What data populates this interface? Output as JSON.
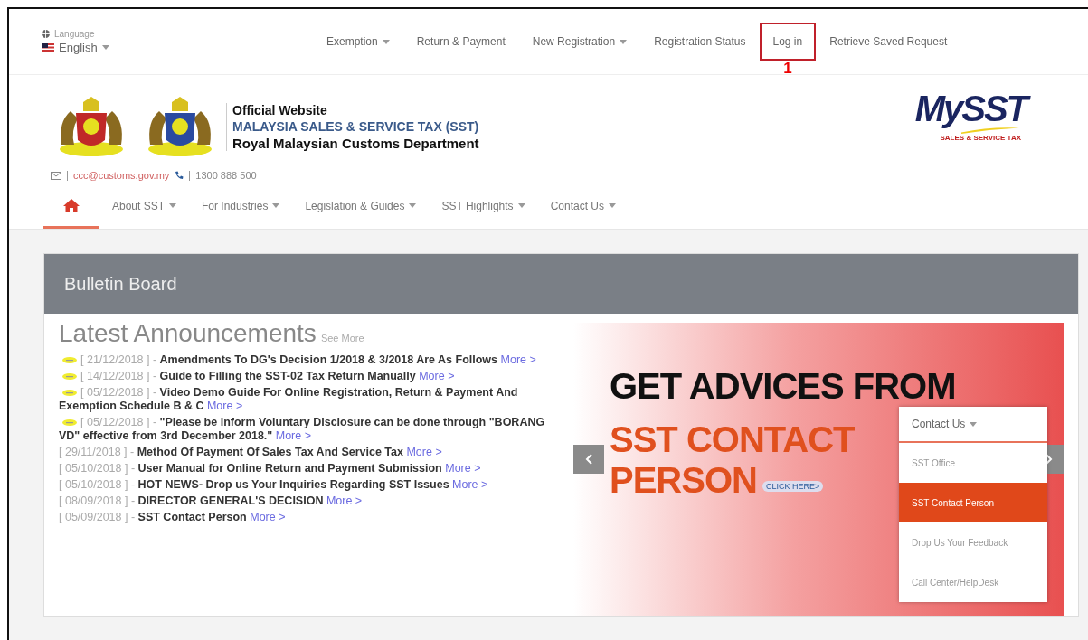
{
  "language": {
    "label": "Language",
    "value": "English"
  },
  "top_nav": [
    {
      "label": "Exemption",
      "dropdown": true,
      "highlighted": false
    },
    {
      "label": "Return & Payment",
      "dropdown": false,
      "highlighted": false
    },
    {
      "label": "New Registration",
      "dropdown": true,
      "highlighted": false
    },
    {
      "label": "Registration Status",
      "dropdown": false,
      "highlighted": false
    },
    {
      "label": "Log in",
      "dropdown": false,
      "highlighted": true,
      "annotation": "1"
    },
    {
      "label": "Retrieve Saved Request",
      "dropdown": false,
      "highlighted": false
    }
  ],
  "header": {
    "line1": "Official Website",
    "line2": "MALAYSIA SALES & SERVICE TAX (SST)",
    "line3": "Royal Malaysian Customs Department",
    "logo": "MySST",
    "logo_tagline": "SALES & SERVICE TAX"
  },
  "contact": {
    "email": "ccc@customs.gov.my",
    "phone": "1300 888 500"
  },
  "main_nav": [
    {
      "kind": "home",
      "selected": true
    },
    {
      "kind": "text",
      "label": "About SST",
      "selected": false
    },
    {
      "kind": "text",
      "label": "For Industries",
      "selected": false
    },
    {
      "kind": "text",
      "label": "Legislation & Guides",
      "selected": false
    },
    {
      "kind": "text",
      "label": "SST Highlights",
      "selected": false
    },
    {
      "kind": "text",
      "label": "Contact Us",
      "selected": false
    }
  ],
  "bulletin": {
    "title": "Bulletin Board",
    "heading": "Latest Announcements",
    "see_more": "See More",
    "items": [
      {
        "new": true,
        "date": "[ 21/12/2018 ] -",
        "title": "Amendments To DG's Decision 1/2018 & 3/2018 Are As Follows",
        "more": "More >"
      },
      {
        "new": true,
        "date": "[ 14/12/2018 ] -",
        "title": "Guide to Filling the SST-02 Tax Return Manually",
        "more": "More >"
      },
      {
        "new": true,
        "date": "[ 05/12/2018 ] -",
        "title": "Video Demo Guide For Online Registration, Return & Payment And Exemption Schedule B & C",
        "more": "More >"
      },
      {
        "new": true,
        "date": "[ 05/12/2018 ] -",
        "title": "\"Please be inform Voluntary Disclosure can be done through \"BORANG VD\" effective from 3rd December 2018.\"",
        "more": "More >"
      },
      {
        "new": false,
        "date": "[ 29/11/2018 ] -",
        "title": "Method Of Payment Of Sales Tax And Service Tax",
        "more": "More >"
      },
      {
        "new": false,
        "date": "[ 05/10/2018 ] -",
        "title": "User Manual for Online Return and Payment Submission",
        "more": "More >"
      },
      {
        "new": false,
        "date": "[ 05/10/2018 ] -",
        "title": "HOT NEWS- Drop us Your Inquiries Regarding SST Issues",
        "more": "More >"
      },
      {
        "new": false,
        "date": "[ 08/09/2018 ] -",
        "title": "DIRECTOR GENERAL'S DECISION",
        "more": "More >"
      },
      {
        "new": false,
        "date": "[ 05/09/2018 ] -",
        "title": "SST Contact Person",
        "more": "More >"
      }
    ]
  },
  "banner": {
    "line1": "GET ADVICES FROM",
    "line2": "SST CONTACT",
    "line3": "PERSON",
    "cta": "CLICK HERE>"
  },
  "dropdown": {
    "label": "Contact Us",
    "items": [
      {
        "label": "SST Office",
        "selected": false
      },
      {
        "label": "SST Contact Person",
        "selected": true
      },
      {
        "label": "Drop Us Your Feedback",
        "selected": false
      },
      {
        "label": "Call Center/HelpDesk",
        "selected": false
      }
    ]
  }
}
